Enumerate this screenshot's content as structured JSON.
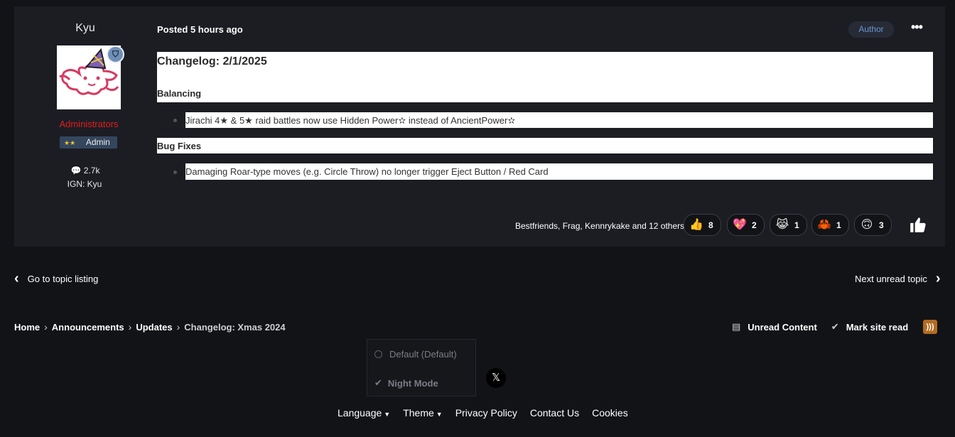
{
  "post": {
    "author": "Kyu",
    "badge_icon": "shield-icon",
    "group": "Administrators",
    "rank_stars": "★★",
    "rank": "Admin",
    "post_count": "2.7k",
    "ign": "IGN: Kyu",
    "posted_label": "Posted 5 hours ago",
    "author_tag": "Author",
    "more_label": "•••"
  },
  "content": {
    "title": "Changelog: 2/1/2025",
    "section1": "Balancing",
    "item1": "Jirachi 4★ & 5★ raid battles now use Hidden Power✫ instead of AncientPower✫",
    "section2": "Bug Fixes",
    "item2": "Damaging Roar-type moves (e.g. Circle Throw) no longer trigger Eject Button / Red Card"
  },
  "reactions": {
    "who": "Bestfriends, Frag, Kennrykake and 12 others",
    "items": [
      {
        "emoji": "👍",
        "count": "8"
      },
      {
        "emoji": "💖",
        "count": "2"
      },
      {
        "emoji": "😹",
        "count": "1"
      },
      {
        "emoji": "🦀",
        "count": "1"
      },
      {
        "emoji": "🙃",
        "count": "3"
      }
    ]
  },
  "nav": {
    "prev": "Go to topic listing",
    "next": "Next unread topic"
  },
  "breadcrumb": [
    "Home",
    "Announcements",
    "Updates",
    "Changelog: Xmas 2024"
  ],
  "actions": {
    "unread": "Unread Content",
    "mark_read": "Mark site read"
  },
  "theme_menu": {
    "opt1": "Default (Default)",
    "opt2": "Night Mode"
  },
  "footer": {
    "language": "Language",
    "theme": "Theme",
    "privacy": "Privacy Policy",
    "contact": "Contact Us",
    "cookies": "Cookies"
  },
  "colors": {
    "background": "#121317",
    "panel": "#1c1d23",
    "admin_group": "#e11d1d",
    "author_tag_text": "#6b96d2",
    "rss": "#b36b22"
  }
}
